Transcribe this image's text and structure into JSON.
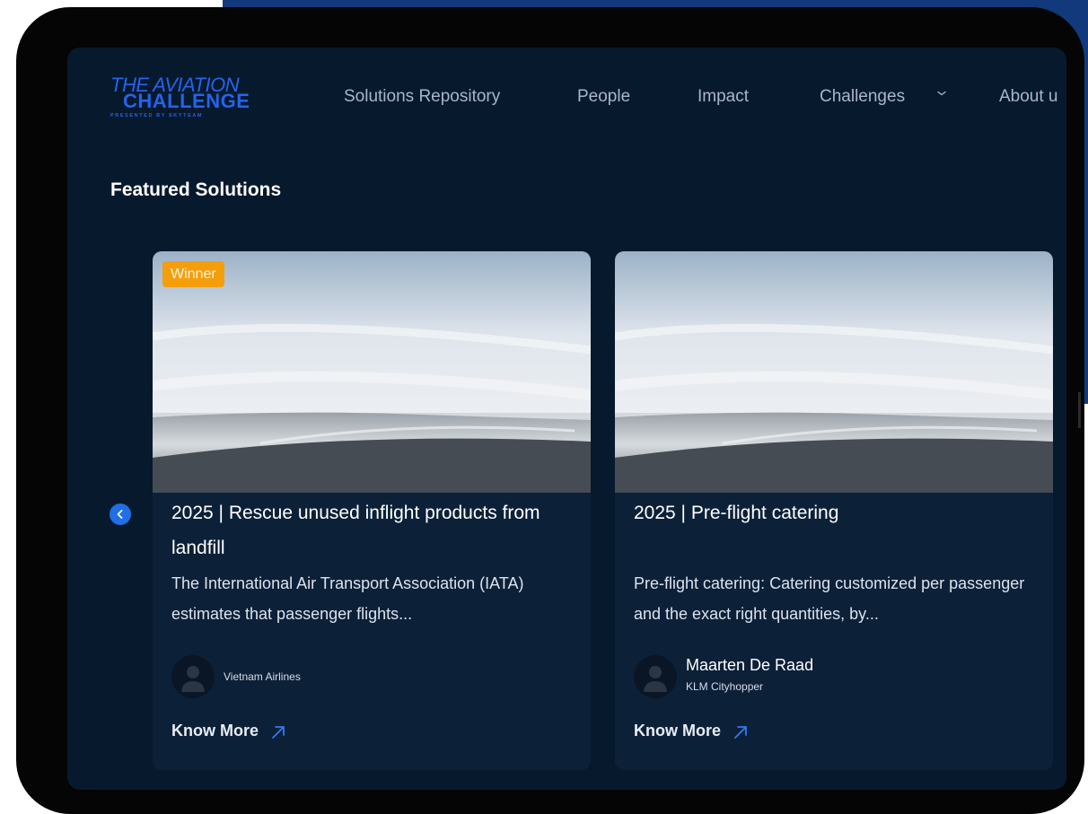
{
  "logo": {
    "line1": "THE AVIATION",
    "line2": "CHALLENGE",
    "line3": "PRESENTED BY SKYTEAM"
  },
  "nav": {
    "items": [
      {
        "label": "Solutions Repository"
      },
      {
        "label": "People"
      },
      {
        "label": "Impact"
      },
      {
        "label": "Challenges"
      },
      {
        "label": "About u"
      }
    ]
  },
  "section": {
    "title": "Featured Solutions"
  },
  "cards": [
    {
      "badge": "Winner",
      "title": "2025 | Rescue unused inflight products from landfill",
      "description": "The International Air Transport Association (IATA) estimates that passenger flights...",
      "author_name": "",
      "author_org": "Vietnam Airlines",
      "cta": "Know More"
    },
    {
      "title": "2025 | Pre-flight catering",
      "description": "Pre-flight catering: Catering customized per passenger and the exact right quantities, by...",
      "author_name": "Maarten De Raad",
      "author_org": "KLM Cityhopper",
      "cta": "Know More"
    }
  ],
  "colors": {
    "brand_blue": "#2563eb",
    "screen_bg": "#07192d",
    "card_bg": "#0c2038",
    "badge": "#f59e0b",
    "backdrop_blue": "#12397c"
  },
  "icons": {
    "carousel_prev": "chevron-left-icon",
    "cta": "arrow-up-right-icon",
    "avatar": "user-silhouette-icon",
    "nav_dropdown": "chevron-down-icon"
  }
}
